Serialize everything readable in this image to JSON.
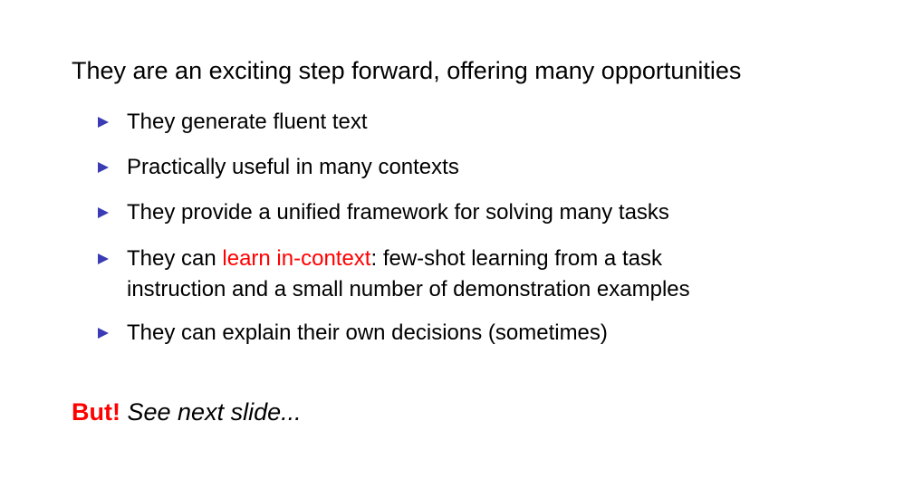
{
  "slide": {
    "heading": "They are an exciting step forward, offering many opportunities",
    "bullets": [
      {
        "text": "They generate fluent text"
      },
      {
        "text": "Practically useful in many contexts"
      },
      {
        "text": "They provide a unified framework for solving many tasks"
      },
      {
        "prefix": "They can ",
        "highlight": "learn in-context",
        "suffix": ": few-shot learning from a task",
        "line2": "instruction and a small number of demonstration examples"
      },
      {
        "text": "They can explain their own decisions (sometimes)"
      }
    ],
    "footer": {
      "emphasis": "But!",
      "italic": "See next slide..."
    }
  },
  "colors": {
    "accent": "#ff0000",
    "bullet_marker": "#3b3bb3",
    "text": "#000000",
    "background": "#ffffff"
  },
  "icons": {
    "bullet": "triangle-bullet-icon"
  }
}
